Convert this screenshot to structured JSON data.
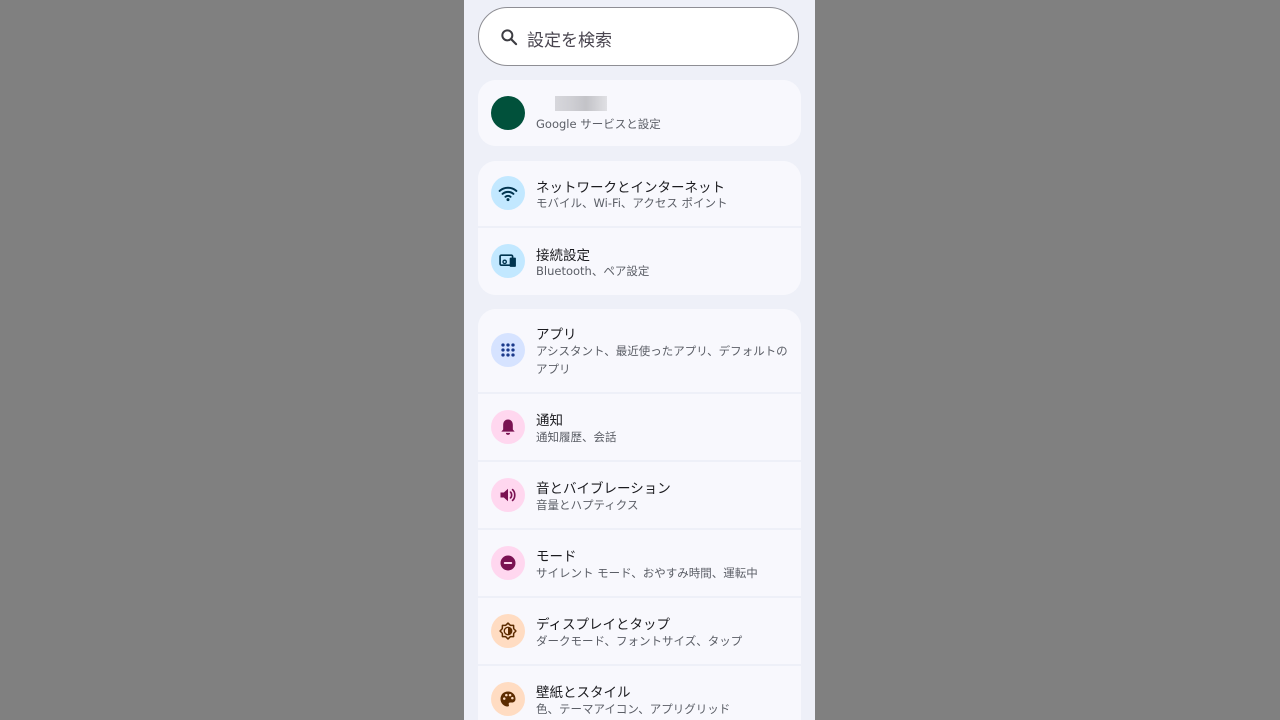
{
  "search": {
    "placeholder": "設定を検索",
    "icon": "search-icon"
  },
  "account": {
    "name": "",
    "subtitle": "Google サービスと設定",
    "avatar_color": "#01513b"
  },
  "groups": [
    {
      "items": [
        {
          "title": "ネットワークとインターネット",
          "subtitle": "モバイル、Wi-Fi、アクセス ポイント",
          "icon": "wifi-icon",
          "icon_bg": "#c2e8ff",
          "icon_color": "#00344f"
        },
        {
          "title": "接続設定",
          "subtitle": "Bluetooth、ペア設定",
          "icon": "connected-devices-icon",
          "icon_bg": "#c2e8ff",
          "icon_color": "#00344f"
        }
      ]
    },
    {
      "items": [
        {
          "title": "アプリ",
          "subtitle": "アシスタント、最近使ったアプリ、デフォルトのアプリ",
          "icon": "apps-grid-icon",
          "icon_bg": "#d6e3ff",
          "icon_color": "#1b3a8b"
        },
        {
          "title": "通知",
          "subtitle": "通知履歴、会話",
          "icon": "bell-icon",
          "icon_bg": "#ffd7ef",
          "icon_color": "#7a1252"
        },
        {
          "title": "音とバイブレーション",
          "subtitle": "音量とハプティクス",
          "icon": "volume-icon",
          "icon_bg": "#ffd7ef",
          "icon_color": "#7a1252"
        },
        {
          "title": "モード",
          "subtitle": "サイレント モード、おやすみ時間、運転中",
          "icon": "do-not-disturb-icon",
          "icon_bg": "#ffd7ef",
          "icon_color": "#7a1252"
        },
        {
          "title": "ディスプレイとタップ",
          "subtitle": "ダークモード、フォントサイズ、タップ",
          "icon": "brightness-icon",
          "icon_bg": "#ffdcc2",
          "icon_color": "#5c2b00"
        },
        {
          "title": "壁紙とスタイル",
          "subtitle": "色、テーマアイコン、アプリグリッド",
          "icon": "palette-icon",
          "icon_bg": "#ffdcc2",
          "icon_color": "#5c2b00"
        }
      ]
    }
  ]
}
